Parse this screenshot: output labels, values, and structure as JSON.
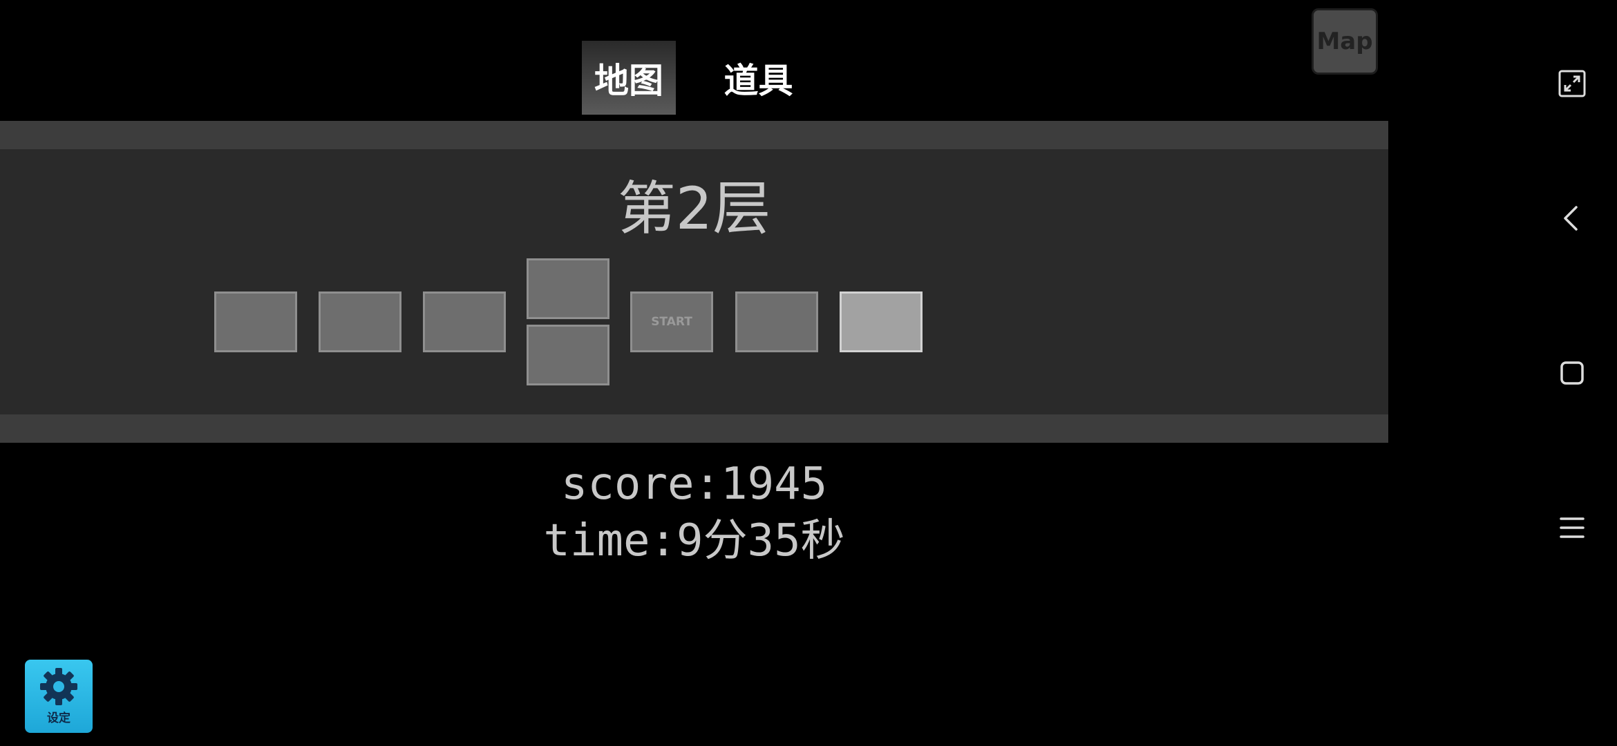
{
  "tabs": [
    {
      "label": "地图",
      "active": true
    },
    {
      "label": "道具",
      "active": false
    }
  ],
  "map_button": {
    "label": "Map"
  },
  "floor": {
    "title": "第2层",
    "start_label": "START"
  },
  "stats": {
    "score": "score:1945",
    "time": "time:9分35秒"
  },
  "settings": {
    "label": "设定"
  },
  "colors": {
    "accent": "#2db8e6",
    "panel": "#2a2a2a",
    "band": "#3d3d3d"
  },
  "nav_icons": [
    "fullscreen-icon",
    "back-icon",
    "home-icon",
    "menu-icon"
  ]
}
